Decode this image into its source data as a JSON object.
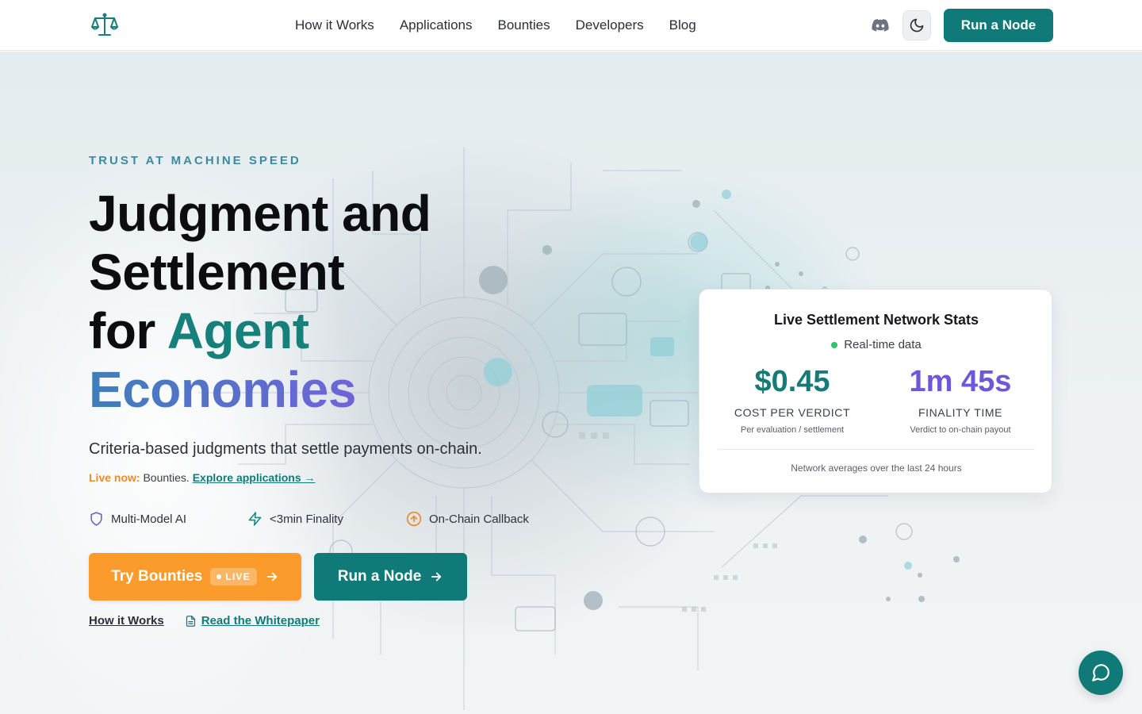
{
  "header": {
    "nav": [
      "How it Works",
      "Applications",
      "Bounties",
      "Developers",
      "Blog"
    ],
    "cta_label": "Run a Node"
  },
  "hero": {
    "eyebrow": "TRUST AT MACHINE SPEED",
    "headline": {
      "line1": "Judgment and",
      "line2": "Settlement",
      "line3_prefix": "for ",
      "line3_accent": "Agent",
      "line4": "Economies"
    },
    "subtitle": "Criteria-based judgments that settle payments on-chain.",
    "live_now_label": "Live now:",
    "live_now_text": " Bounties. ",
    "explore_link": "Explore applications →",
    "features": [
      "Multi-Model AI",
      "<3min Finality",
      "On-Chain Callback"
    ],
    "try_button": "Try Bounties",
    "live_badge": "LIVE",
    "run_button": "Run a Node",
    "link_how": "How it Works",
    "link_whitepaper": "Read the Whitepaper"
  },
  "stats_card": {
    "title": "Live Settlement Network Stats",
    "realtime": "Real-time data",
    "stat1": {
      "value": "$0.45",
      "label": "COST PER VERDICT",
      "sub": "Per evaluation / settlement"
    },
    "stat2": {
      "value": "1m 45s",
      "label": "FINALITY TIME",
      "sub": "Verdict to on-chain payout"
    },
    "footer": "Network averages over the last 24 hours"
  },
  "icons": {
    "logo": "scales-icon",
    "discord": "discord-icon",
    "theme": "moon-icon",
    "chat": "chat-bubble-icon"
  },
  "colors": {
    "brand_teal": "#0f7a78",
    "accent_orange": "#fa9b2b",
    "accent_purple": "#6e57d8",
    "eyebrow_blue": "#3b8aa0"
  }
}
